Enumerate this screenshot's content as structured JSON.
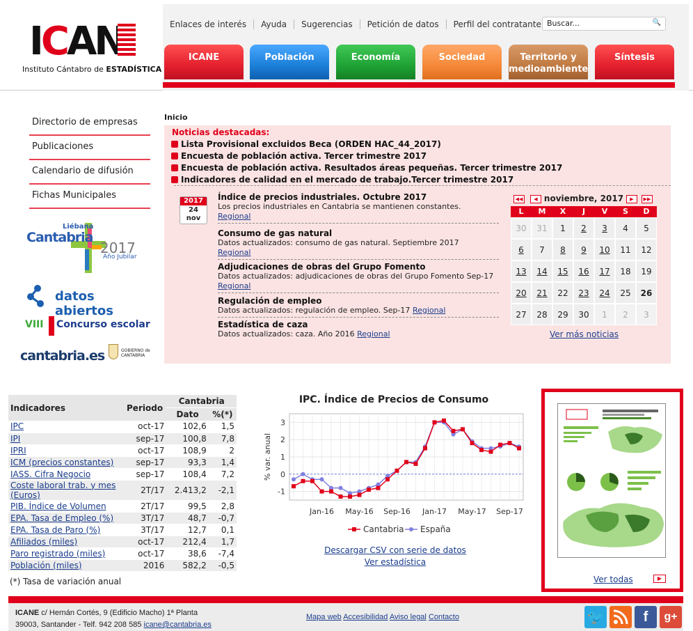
{
  "header": {
    "logo_sub_prefix": "Instituto Cántabro de ",
    "logo_sub_bold": "ESTADÍSTICA",
    "top_links": [
      "Enlaces de interés",
      "Ayuda",
      "Sugerencias",
      "Petición de datos",
      "Perfil del contratante"
    ],
    "search_placeholder": "Buscar...",
    "tabs": [
      {
        "label": "ICANE",
        "color": "#e4202e"
      },
      {
        "label": "Población",
        "color": "#1c7fd8"
      },
      {
        "label": "Economía",
        "color": "#1fa335"
      },
      {
        "label": "Sociedad",
        "color": "#f5893a"
      },
      {
        "label": "Territorio y medioambiente",
        "color": "#c07a42"
      },
      {
        "label": "Síntesis",
        "color": "#e4202e"
      }
    ]
  },
  "leftnav": {
    "items": [
      "Directorio de empresas",
      "Publicaciones",
      "Calendario de difusión",
      "Fichas Municipales"
    ],
    "promos": {
      "liebana": "Liébana",
      "cantabria": "Cantabria",
      "year": "2017",
      "jubilar": "Año Jubilar",
      "datos_abiertos": "datos abiertos",
      "viii": "VIII",
      "concurso": "Concurso escolar",
      "cantabria_es": "cantabria.es",
      "gobierno": "GOBIERNO de CANTABRIA"
    }
  },
  "breadcrumb": "Inicio",
  "destacadas": {
    "title": "Noticias destacadas:",
    "items": [
      "Lista Provisional excluidos Beca (ORDEN HAC_44_2017)",
      "Encuesta de población activa. Tercer trimestre 2017",
      "Encuesta de población activa. Resultados áreas pequeñas. Tercer trimestre 2017",
      "Indicadores de calidad en el mercado de trabajo.Tercer trimestre 2017"
    ]
  },
  "date_badge": {
    "year": "2017",
    "day": "24",
    "month": "nov"
  },
  "news": [
    {
      "title": "Índice de precios industriales. Octubre 2017",
      "desc": "Los precios industriales en Cantabria se mantienen constantes.",
      "link": "Regional"
    },
    {
      "title": "Consumo de gas natural",
      "desc": "Datos actualizados: consumo de gas natural. Septiembre 2017",
      "link": "Regional"
    },
    {
      "title": "Adjudicaciones de obras del Grupo Fomento",
      "desc": "Datos actualizados: adjudicaciones de obras del Grupo Fomento Sep-17",
      "link": "Regional"
    },
    {
      "title": "Regulación de empleo",
      "desc": "Datos actualizados: regulación de empleo. Sep-17",
      "link": "Regional"
    },
    {
      "title": "Estadística de caza",
      "desc": "Datos actualizados: caza. Año 2016",
      "link": "Regional"
    }
  ],
  "calendar": {
    "month_label": "noviembre, 2017",
    "weekdays": [
      "L",
      "M",
      "X",
      "J",
      "V",
      "S",
      "D"
    ],
    "days": [
      {
        "d": "30",
        "t": "out"
      },
      {
        "d": "31",
        "t": "out"
      },
      {
        "d": "1",
        "t": "plain"
      },
      {
        "d": "2",
        "t": "link"
      },
      {
        "d": "3",
        "t": "link"
      },
      {
        "d": "4",
        "t": "plain"
      },
      {
        "d": "5",
        "t": "plain"
      },
      {
        "d": "6",
        "t": "link"
      },
      {
        "d": "7",
        "t": "plain"
      },
      {
        "d": "8",
        "t": "link"
      },
      {
        "d": "9",
        "t": "link"
      },
      {
        "d": "10",
        "t": "link"
      },
      {
        "d": "11",
        "t": "plain"
      },
      {
        "d": "12",
        "t": "plain"
      },
      {
        "d": "13",
        "t": "link"
      },
      {
        "d": "14",
        "t": "link"
      },
      {
        "d": "15",
        "t": "link"
      },
      {
        "d": "16",
        "t": "link"
      },
      {
        "d": "17",
        "t": "link"
      },
      {
        "d": "18",
        "t": "plain"
      },
      {
        "d": "19",
        "t": "plain"
      },
      {
        "d": "20",
        "t": "link"
      },
      {
        "d": "21",
        "t": "link"
      },
      {
        "d": "22",
        "t": "plain"
      },
      {
        "d": "23",
        "t": "link"
      },
      {
        "d": "24",
        "t": "link"
      },
      {
        "d": "25",
        "t": "plain"
      },
      {
        "d": "26",
        "t": "today"
      },
      {
        "d": "27",
        "t": "plain"
      },
      {
        "d": "28",
        "t": "plain"
      },
      {
        "d": "29",
        "t": "plain"
      },
      {
        "d": "30",
        "t": "plain"
      },
      {
        "d": "1",
        "t": "out"
      },
      {
        "d": "2",
        "t": "out"
      },
      {
        "d": "3",
        "t": "out"
      }
    ],
    "more_news": "Ver más noticias"
  },
  "indicators": {
    "headers": {
      "name": "Indicadores",
      "period": "Periodo",
      "region": "Cantabria",
      "dato": "Dato",
      "pct": "%(*)"
    },
    "rows": [
      {
        "name": "IPC",
        "period": "oct-17",
        "dato": "102,6",
        "pct": "1,5"
      },
      {
        "name": "IPI",
        "period": "sep-17",
        "dato": "100,8",
        "pct": "7,8"
      },
      {
        "name": "IPRI",
        "period": "oct-17",
        "dato": "108,9",
        "pct": "2"
      },
      {
        "name": "ICM (precios constantes)",
        "period": "sep-17",
        "dato": "93,3",
        "pct": "1,4"
      },
      {
        "name": "IASS. Cifra Negocio",
        "period": "sep-17",
        "dato": "108,4",
        "pct": "7,2"
      },
      {
        "name": "Coste laboral trab. y mes (Euros)",
        "period": "2T/17",
        "dato": "2.413,2",
        "pct": "-2,1"
      },
      {
        "name": "PIB. Índice de Volumen",
        "period": "2T/17",
        "dato": "99,5",
        "pct": "2,8"
      },
      {
        "name": "EPA. Tasa de Empleo (%)",
        "period": "3T/17",
        "dato": "48,7",
        "pct": "-0,7"
      },
      {
        "name": "EPA. Tasa de Paro (%)",
        "period": "3T/17",
        "dato": "12,7",
        "pct": "0,1"
      },
      {
        "name": "Afiliados (miles)",
        "period": "oct-17",
        "dato": "212,4",
        "pct": "1,7"
      },
      {
        "name": "Paro registrado (miles)",
        "period": "oct-17",
        "dato": "38,6",
        "pct": "-7,4"
      },
      {
        "name": "Población (miles)",
        "period": "2016",
        "dato": "582,2",
        "pct": "-0,5"
      }
    ],
    "footnote": "(*) Tasa de variación anual"
  },
  "chart_data": {
    "type": "line",
    "title": "IPC. Índice de Precios de Consumo",
    "ylabel": "% var. anual",
    "ylim": [
      -1.5,
      3.5
    ],
    "yticks": [
      -1,
      0,
      1,
      2,
      3
    ],
    "x": [
      "Oct-15",
      "Nov-15",
      "Dic-15",
      "Jan-16",
      "Feb-16",
      "Mar-16",
      "Apr-16",
      "May-16",
      "Jun-16",
      "Jul-16",
      "Aug-16",
      "Sep-16",
      "Oct-16",
      "Nov-16",
      "Dic-16",
      "Jan-17",
      "Feb-17",
      "Mar-17",
      "Apr-17",
      "May-17",
      "Jun-17",
      "Jul-17",
      "Aug-17",
      "Sep-17",
      "Oct-17"
    ],
    "xtick_labels": [
      "Jan-16",
      "May-16",
      "Sep-16",
      "Jan-17",
      "May-17",
      "Sep-17"
    ],
    "grid": true,
    "legend_position": "bottom",
    "series": [
      {
        "name": "Cantabria",
        "color": "#e0001b",
        "marker": "square",
        "values": [
          -0.7,
          -0.4,
          -0.4,
          -1.0,
          -1.0,
          -1.3,
          -1.3,
          -1.2,
          -0.9,
          -0.8,
          -0.3,
          0.2,
          0.7,
          0.6,
          1.5,
          3.0,
          3.1,
          2.5,
          2.6,
          1.8,
          1.4,
          1.3,
          1.7,
          1.8,
          1.5
        ]
      },
      {
        "name": "España",
        "color": "#8080e0",
        "marker": "circle",
        "values": [
          -0.3,
          0.0,
          -0.3,
          -0.3,
          -0.8,
          -0.8,
          -1.1,
          -1.0,
          -0.8,
          -0.6,
          -0.1,
          0.2,
          0.7,
          0.7,
          1.6,
          3.0,
          3.0,
          2.3,
          2.6,
          1.9,
          1.5,
          1.5,
          1.6,
          1.8,
          1.6
        ]
      }
    ]
  },
  "chart_links": {
    "csv": "Descargar CSV con serie de datos",
    "stats": "Ver estadística"
  },
  "infographic": {
    "ver_todas": "Ver todas"
  },
  "footer": {
    "org": "ICANE",
    "address1": " c/ Hernán Cortés, 9 (Edificio Macho) 1ª Planta",
    "address2": "39003, Santander - Telf. 942 208 585 ",
    "email": "icane@cantabria.es",
    "links": [
      "Mapa web",
      "Accesibilidad",
      "Aviso legal",
      "Contacto"
    ]
  }
}
